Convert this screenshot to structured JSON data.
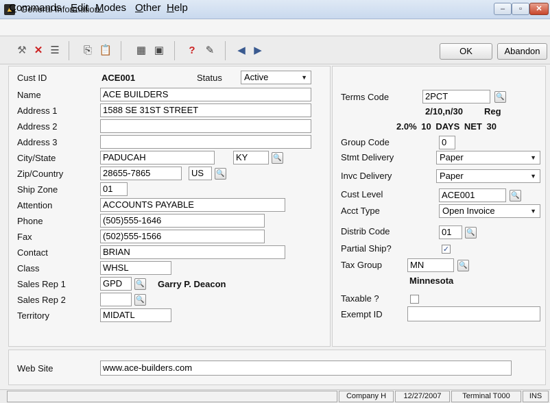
{
  "window": {
    "title": "General Information",
    "app_icon": "app-icon",
    "min": "‒",
    "max": "▫",
    "close": "✕"
  },
  "menu": [
    {
      "label": "Commands",
      "ul": "C",
      "rest": "ommands"
    },
    {
      "label": "Edit",
      "ul": "E",
      "rest": "dit"
    },
    {
      "label": "Modes",
      "ul": "M",
      "rest": "odes"
    },
    {
      "label": "Other",
      "ul": "O",
      "rest": "ther"
    },
    {
      "label": "Help",
      "ul": "H",
      "rest": "elp"
    }
  ],
  "toolbar": {
    "ok_label": "OK",
    "abandon_label": "Abandon"
  },
  "left": {
    "cust_id_label": "Cust ID",
    "cust_id": "ACE001",
    "status_label": "Status",
    "status": "Active",
    "name_label": "Name",
    "name": "ACE BUILDERS",
    "address1_label": "Address 1",
    "address1": "1588 SE 31ST STREET",
    "address2_label": "Address 2",
    "address2": "",
    "address3_label": "Address 3",
    "address3": "",
    "citystate_label": "City/State",
    "city": "PADUCAH",
    "state": "KY",
    "zip_label": "Zip/Country",
    "zip": "28655-7865",
    "country": "US",
    "shipzone_label": "Ship Zone",
    "shipzone": "01",
    "attention_label": "Attention",
    "attention": "ACCOUNTS PAYABLE",
    "phone_label": "Phone",
    "phone": "(505)555-1646",
    "fax_label": "Fax",
    "fax": "(502)555-1566",
    "contact_label": "Contact",
    "contact": "BRIAN",
    "class_label": "Class",
    "class": "WHSL",
    "salesrep1_label": "Sales Rep 1",
    "salesrep1": "GPD",
    "salesrep1_name": "Garry P. Deacon",
    "salesrep2_label": "Sales Rep 2",
    "salesrep2": "",
    "territory_label": "Territory",
    "territory": "MIDATL"
  },
  "right": {
    "terms_label": "Terms Code",
    "terms": "2PCT",
    "terms_desc1": "2/10,n/30",
    "terms_desc1_type": "Reg",
    "terms_desc2": "2.0%  10 DAYS  NET 30",
    "group_label": "Group Code",
    "group": "0",
    "stmt_label": "Stmt Delivery",
    "stmt": "Paper",
    "invc_label": "Invc Delivery",
    "invc": "Paper",
    "custlevel_label": "Cust Level",
    "custlevel": "ACE001",
    "accttype_label": "Acct Type",
    "accttype": "Open Invoice",
    "distrib_label": "Distrib Code",
    "distrib": "01",
    "partial_label": "Partial Ship?",
    "partial_checked": true,
    "taxgroup_label": "Tax Group",
    "taxgroup": "MN",
    "taxgroup_name": "Minnesota",
    "taxable_label": "Taxable ?",
    "taxable_checked": false,
    "exempt_label": "Exempt ID",
    "exempt": ""
  },
  "web": {
    "label": "Web Site",
    "value": "www.ace-builders.com"
  },
  "status": {
    "company": "Company H",
    "date": "12/27/2007",
    "terminal": "Terminal T000",
    "mode": "INS"
  },
  "icons": {
    "lookup": "magnifier-icon",
    "checkmark": "✓"
  }
}
